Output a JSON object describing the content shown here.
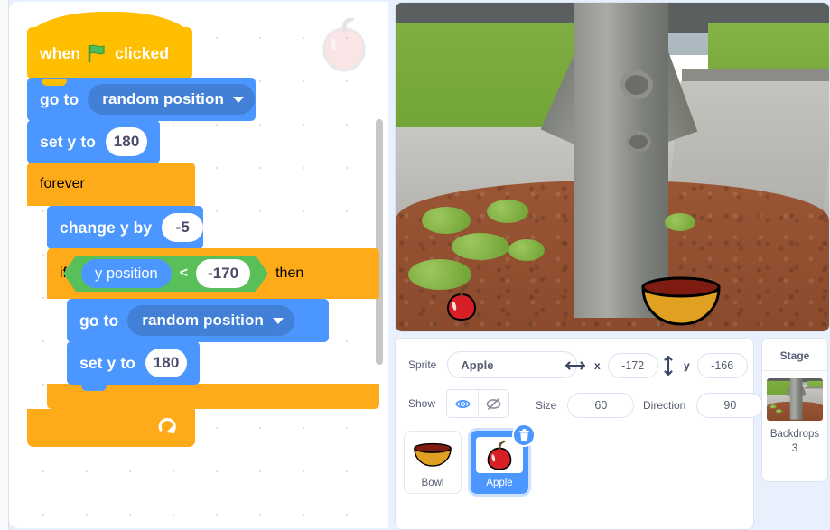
{
  "workspace": {
    "watermark_icon": "apple-watermark",
    "scrollbar": "vertical-scrollbar"
  },
  "script": {
    "hat": {
      "text_before": "when",
      "icon": "green-flag-icon",
      "text_after": "clicked"
    },
    "goto_1": {
      "label": "go to",
      "value": "random position"
    },
    "sety_1": {
      "label": "set y to",
      "value": "180"
    },
    "forever": {
      "label": "forever",
      "loop_icon": "loop-arrow-icon"
    },
    "change_y": {
      "label": "change y by",
      "value": "-5"
    },
    "if_block": {
      "label": "if",
      "then": "then",
      "operand_left": "y position",
      "operator": "<",
      "operand_right": "-170"
    },
    "goto_2": {
      "label": "go to",
      "value": "random position"
    },
    "sety_2": {
      "label": "set y to",
      "value": "180"
    }
  },
  "stage": {
    "sprites_on_stage": [
      {
        "name": "Apple",
        "icon": "apple-sprite"
      },
      {
        "name": "Bowl",
        "icon": "bowl-sprite"
      }
    ],
    "backdrop_description": "tree-trunk-backdrop"
  },
  "sprite_info": {
    "sprite_label": "Sprite",
    "sprite_name": "Apple",
    "x_label": "x",
    "x_value": "-172",
    "y_label": "y",
    "y_value": "-166",
    "x_icon": "horizontal-arrows-icon",
    "y_icon": "vertical-arrows-icon",
    "show_label": "Show",
    "show_on_icon": "eye-icon",
    "show_off_icon": "eye-crossed-icon",
    "size_label": "Size",
    "size_value": "60",
    "direction_label": "Direction",
    "direction_value": "90"
  },
  "sprite_list": [
    {
      "name": "Bowl",
      "icon": "bowl-sprite",
      "selected": false
    },
    {
      "name": "Apple",
      "icon": "apple-sprite",
      "selected": true,
      "delete_icon": "trash-icon"
    }
  ],
  "stage_selector": {
    "title": "Stage",
    "backdrops_label": "Backdrops",
    "backdrops_count": "3",
    "thumbnail": "tree-trunk-backdrop"
  },
  "colors": {
    "events": "#FFBF00",
    "motion": "#4C97FF",
    "control": "#FFAB19",
    "operators": "#59C059",
    "accent": "#4C97FF",
    "text_muted": "#575E75"
  }
}
